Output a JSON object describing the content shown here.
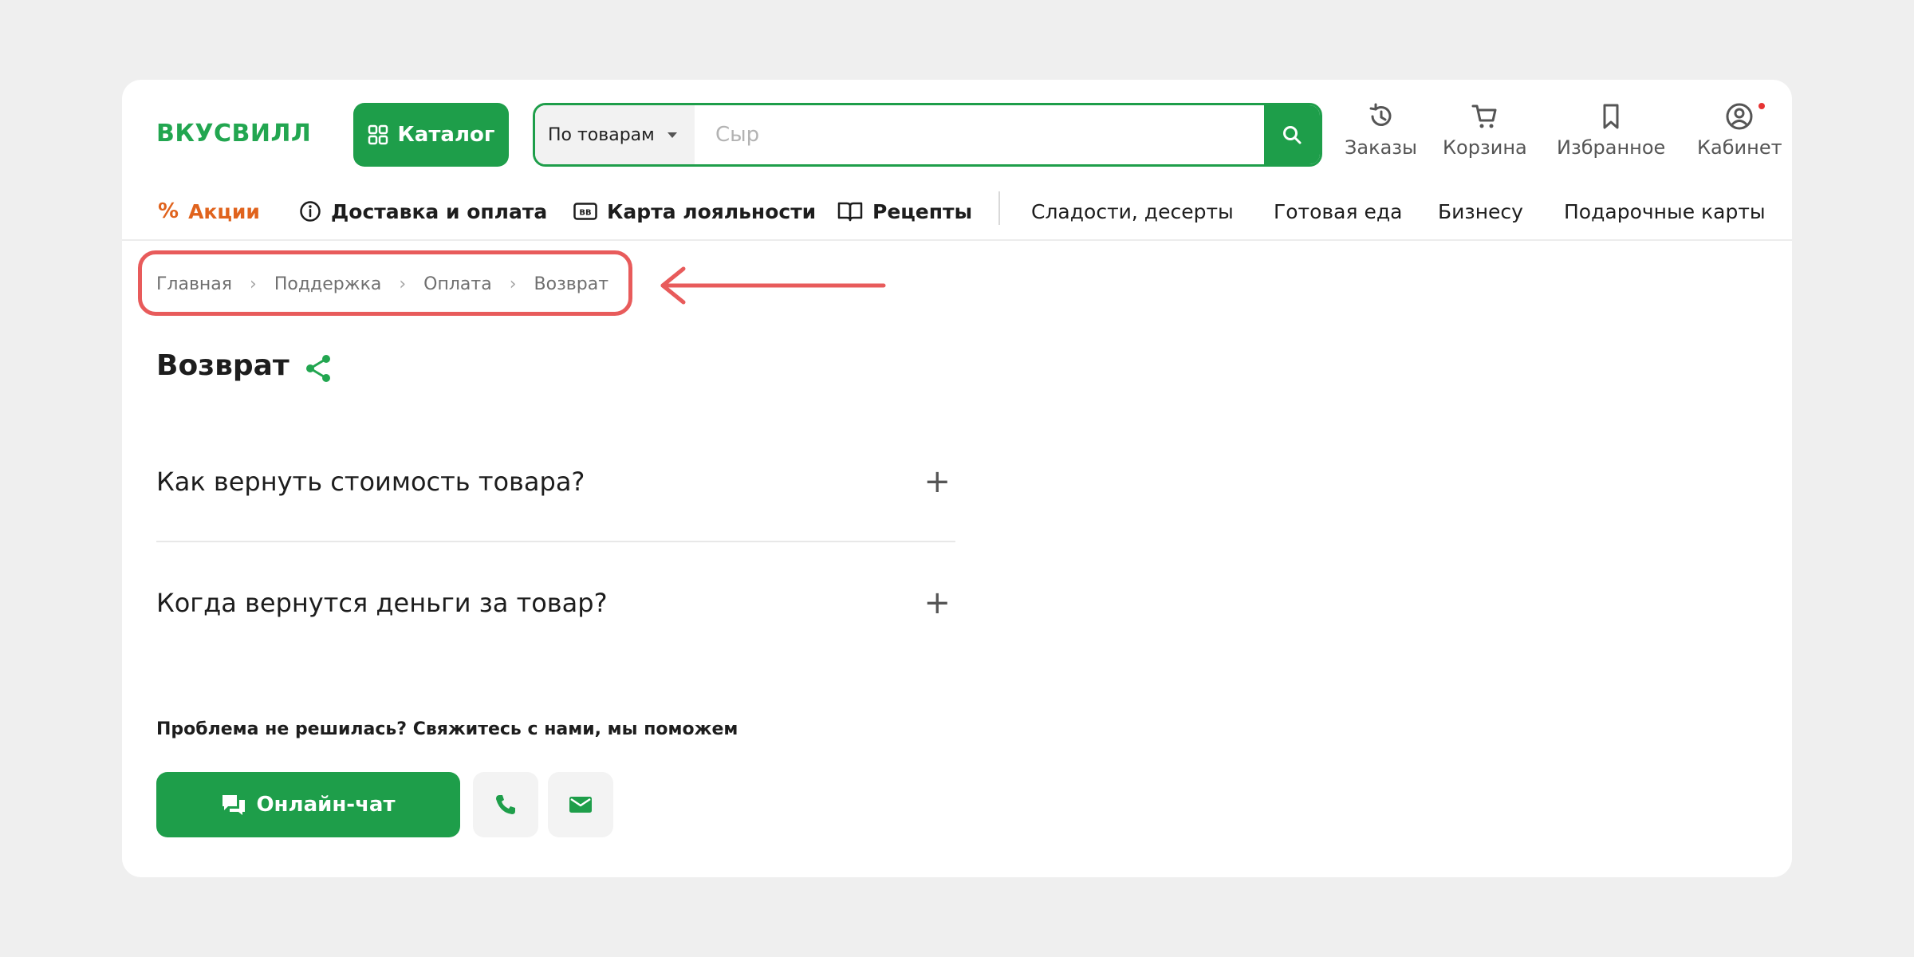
{
  "brand": {
    "logo": "ВКУСВИЛЛ"
  },
  "header": {
    "catalog_label": "Каталог",
    "search_scope": "По товарам",
    "search_placeholder": "Сыр",
    "icons": [
      {
        "id": "orders",
        "label": "Заказы"
      },
      {
        "id": "cart",
        "label": "Корзина"
      },
      {
        "id": "favorites",
        "label": "Избранное"
      },
      {
        "id": "account",
        "label": "Кабинет"
      }
    ]
  },
  "nav": {
    "items": [
      {
        "label": "Акции"
      },
      {
        "label": "Доставка и оплата"
      },
      {
        "label": "Карта лояльности"
      },
      {
        "label": "Рецепты"
      },
      {
        "label": "Сладости, десерты"
      },
      {
        "label": "Готовая еда"
      },
      {
        "label": "Бизнесу"
      },
      {
        "label": "Подарочные карты"
      }
    ]
  },
  "breadcrumb": [
    "Главная",
    "Поддержка",
    "Оплата",
    "Возврат"
  ],
  "page": {
    "title": "Возврат"
  },
  "faq": [
    {
      "question": "Как вернуть стоимость товара?"
    },
    {
      "question": "Когда вернутся деньги за товар?"
    }
  ],
  "contact": {
    "prompt": "Проблема не решилась? Свяжитесь с нами, мы поможем",
    "chat_label": "Онлайн-чат"
  },
  "colors": {
    "brand_green": "#1e9e4a",
    "promo_orange": "#e0631d",
    "highlight_red": "#e85b5b"
  }
}
